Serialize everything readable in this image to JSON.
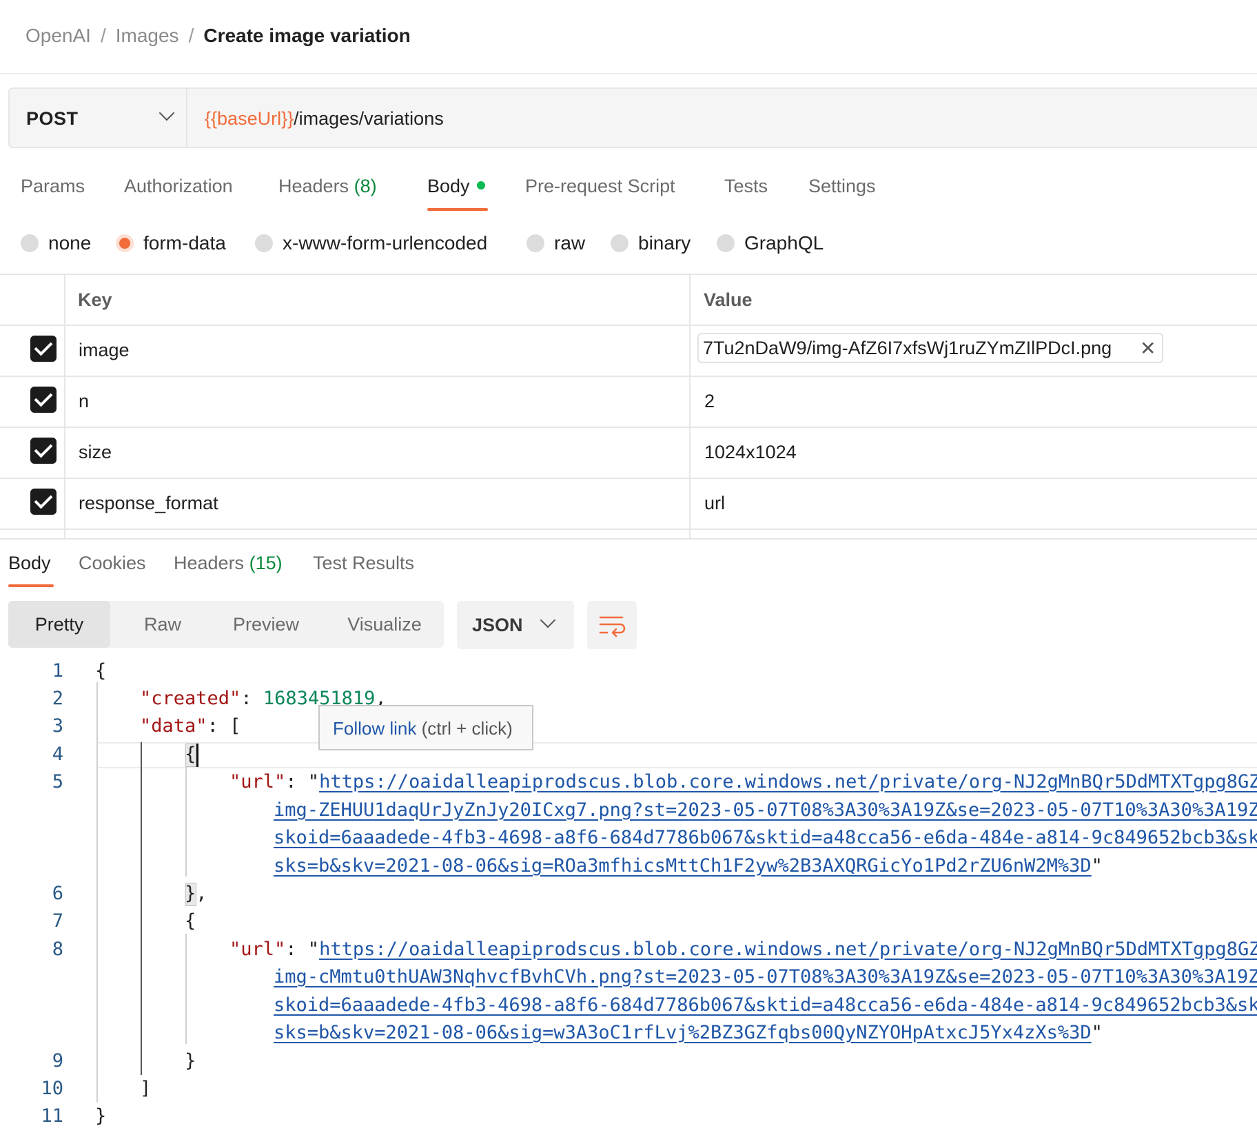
{
  "breadcrumb": {
    "items": [
      "OpenAI",
      "Images"
    ],
    "separator": "/",
    "current": "Create image variation"
  },
  "request": {
    "method": "POST",
    "url_variable": "{{baseUrl}}",
    "url_path": "/images/variations"
  },
  "request_tabs": {
    "params": "Params",
    "authorization": "Authorization",
    "headers": "Headers",
    "headers_count": "(8)",
    "body": "Body",
    "pre_request": "Pre-request Script",
    "tests": "Tests",
    "settings": "Settings",
    "active": "Body"
  },
  "body_types": {
    "options": [
      "none",
      "form-data",
      "x-www-form-urlencoded",
      "raw",
      "binary",
      "GraphQL"
    ],
    "selected": "form-data"
  },
  "form_table": {
    "headers": {
      "key": "Key",
      "value": "Value"
    },
    "rows": [
      {
        "checked": true,
        "key": "image",
        "value": "7Tu2nDaW9/img-AfZ6I7xfsWj1ruZYmZIlPDcI.png",
        "is_file": true
      },
      {
        "checked": true,
        "key": "n",
        "value": "2"
      },
      {
        "checked": true,
        "key": "size",
        "value": "1024x1024"
      },
      {
        "checked": true,
        "key": "response_format",
        "value": "url"
      }
    ]
  },
  "response_tabs": {
    "body": "Body",
    "cookies": "Cookies",
    "headers": "Headers",
    "headers_count": "(15)",
    "test_results": "Test Results",
    "active": "Body"
  },
  "view_modes": {
    "options": [
      "Pretty",
      "Raw",
      "Preview",
      "Visualize"
    ],
    "selected": "Pretty"
  },
  "format": {
    "selected": "JSON"
  },
  "tooltip": {
    "link": "Follow link",
    "hint": "(ctrl + click)"
  },
  "code": {
    "line_numbers": [
      "1",
      "2",
      "3",
      "4",
      "5",
      "6",
      "7",
      "8",
      "9",
      "10",
      "11"
    ],
    "open_brace": "{",
    "close_brace": "}",
    "created_key": "\"created\"",
    "created_value": "1683451819",
    "data_key": "\"data\"",
    "open_bracket": "[",
    "close_bracket": "]",
    "url_key": "\"url\"",
    "urls": [
      {
        "lines": [
          "https://oaidalleapiprodscus.blob.core.windows.net/private/org-NJ2gMnBQr5DdMTXTgpg8GZ",
          "img-ZEHUU1daqUrJyZnJy20ICxg7.png?st=2023-05-07T08%3A30%3A19Z&se=2023-05-07T10%3A30%3A19Z",
          "skoid=6aaadede-4fb3-4698-a8f6-684d7786b067&sktid=a48cca56-e6da-484e-a814-9c849652bcb3&sk",
          "sks=b&skv=2021-08-06&sig=ROa3mfhicsMttCh1F2yw%2B3AXQRGicYo1Pd2rZU6nW2M%3D"
        ]
      },
      {
        "lines": [
          "https://oaidalleapiprodscus.blob.core.windows.net/private/org-NJ2gMnBQr5DdMTXTgpg8GZ",
          "img-cMmtu0thUAW3NqhvcfBvhCVh.png?st=2023-05-07T08%3A30%3A19Z&se=2023-05-07T10%3A30%3A19Z",
          "skoid=6aaadede-4fb3-4698-a8f6-684d7786b067&sktid=a48cca56-e6da-484e-a814-9c849652bcb3&sk",
          "sks=b&skv=2021-08-06&sig=w3A3oC1rfLvj%2BZ3GZfqbs00QyNZYOHpAtxcJ5Yx4zXs%3D"
        ]
      }
    ]
  },
  "colors": {
    "accent": "#f26b3a",
    "green_count": "#0a8a3c",
    "green_dot": "#0cbb52",
    "json_key": "#a31515",
    "json_number": "#098658",
    "link": "#1f56a8",
    "line_number": "#2b5a88"
  },
  "icons": {
    "method_dropdown": "chevron-down-icon",
    "remove_file": "close-icon",
    "format_dropdown": "chevron-down-icon",
    "wrap": "word-wrap-icon",
    "checkbox": "check-icon"
  }
}
